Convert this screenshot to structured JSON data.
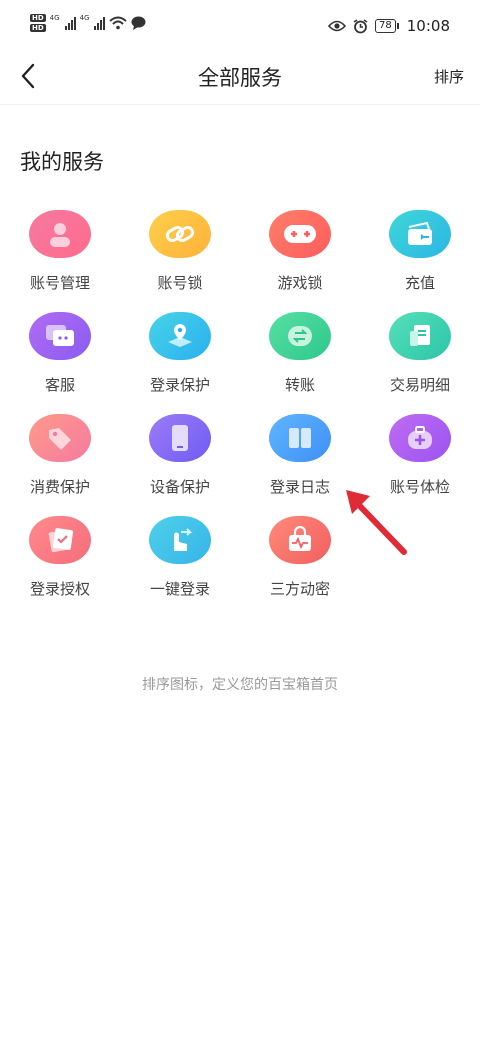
{
  "status_bar": {
    "hd1": "HD",
    "hd2": "HD",
    "net1": "4G",
    "net2": "4G",
    "battery": "78",
    "time": "10:08"
  },
  "nav": {
    "title": "全部服务",
    "sort_label": "排序",
    "back_icon": "chevron-left-icon"
  },
  "section": {
    "title": "我的服务"
  },
  "services": [
    {
      "label": "账号管理",
      "icon": "person-icon",
      "colors": [
        "#f57aa0",
        "#ff6b8d"
      ]
    },
    {
      "label": "账号锁",
      "icon": "link-icon",
      "colors": [
        "#ffcf4b",
        "#ffb23a"
      ]
    },
    {
      "label": "游戏锁",
      "icon": "gamepad-icon",
      "colors": [
        "#ff7f6a",
        "#ff5c5c"
      ]
    },
    {
      "label": "充值",
      "icon": "wallet-icon",
      "colors": [
        "#3fd7d7",
        "#2bb6e6"
      ]
    },
    {
      "label": "客服",
      "icon": "chat-icon",
      "colors": [
        "#b06cf3",
        "#8a5cf2"
      ]
    },
    {
      "label": "登录保护",
      "icon": "location-map-icon",
      "colors": [
        "#47d4e8",
        "#2ab0ef"
      ]
    },
    {
      "label": "转账",
      "icon": "transfer-icon",
      "colors": [
        "#57e0a3",
        "#2ec78b"
      ]
    },
    {
      "label": "交易明细",
      "icon": "receipt-icon",
      "colors": [
        "#55e0b9",
        "#2cc5a8"
      ]
    },
    {
      "label": "消费保护",
      "icon": "tag-icon",
      "colors": [
        "#ff9a8a",
        "#f57aa0"
      ]
    },
    {
      "label": "设备保护",
      "icon": "phone-icon",
      "colors": [
        "#9c7cf8",
        "#6f5cf2"
      ]
    },
    {
      "label": "登录日志",
      "icon": "book-icon",
      "colors": [
        "#5fb6ff",
        "#3f8ff5"
      ]
    },
    {
      "label": "账号体检",
      "icon": "medkit-icon",
      "colors": [
        "#c06cf3",
        "#9a54f0"
      ]
    },
    {
      "label": "登录授权",
      "icon": "auth-card-icon",
      "colors": [
        "#ff8a8a",
        "#f56d7d"
      ]
    },
    {
      "label": "一键登录",
      "icon": "tap-hand-icon",
      "colors": [
        "#4fd0e8",
        "#36b4ea"
      ]
    },
    {
      "label": "三方动密",
      "icon": "pulse-lock-icon",
      "colors": [
        "#ff8a7a",
        "#f25f5f"
      ]
    }
  ],
  "footer_hint": "排序图标，定义您的百宝箱首页",
  "annotation": {
    "arrow_color": "#e02a36"
  }
}
